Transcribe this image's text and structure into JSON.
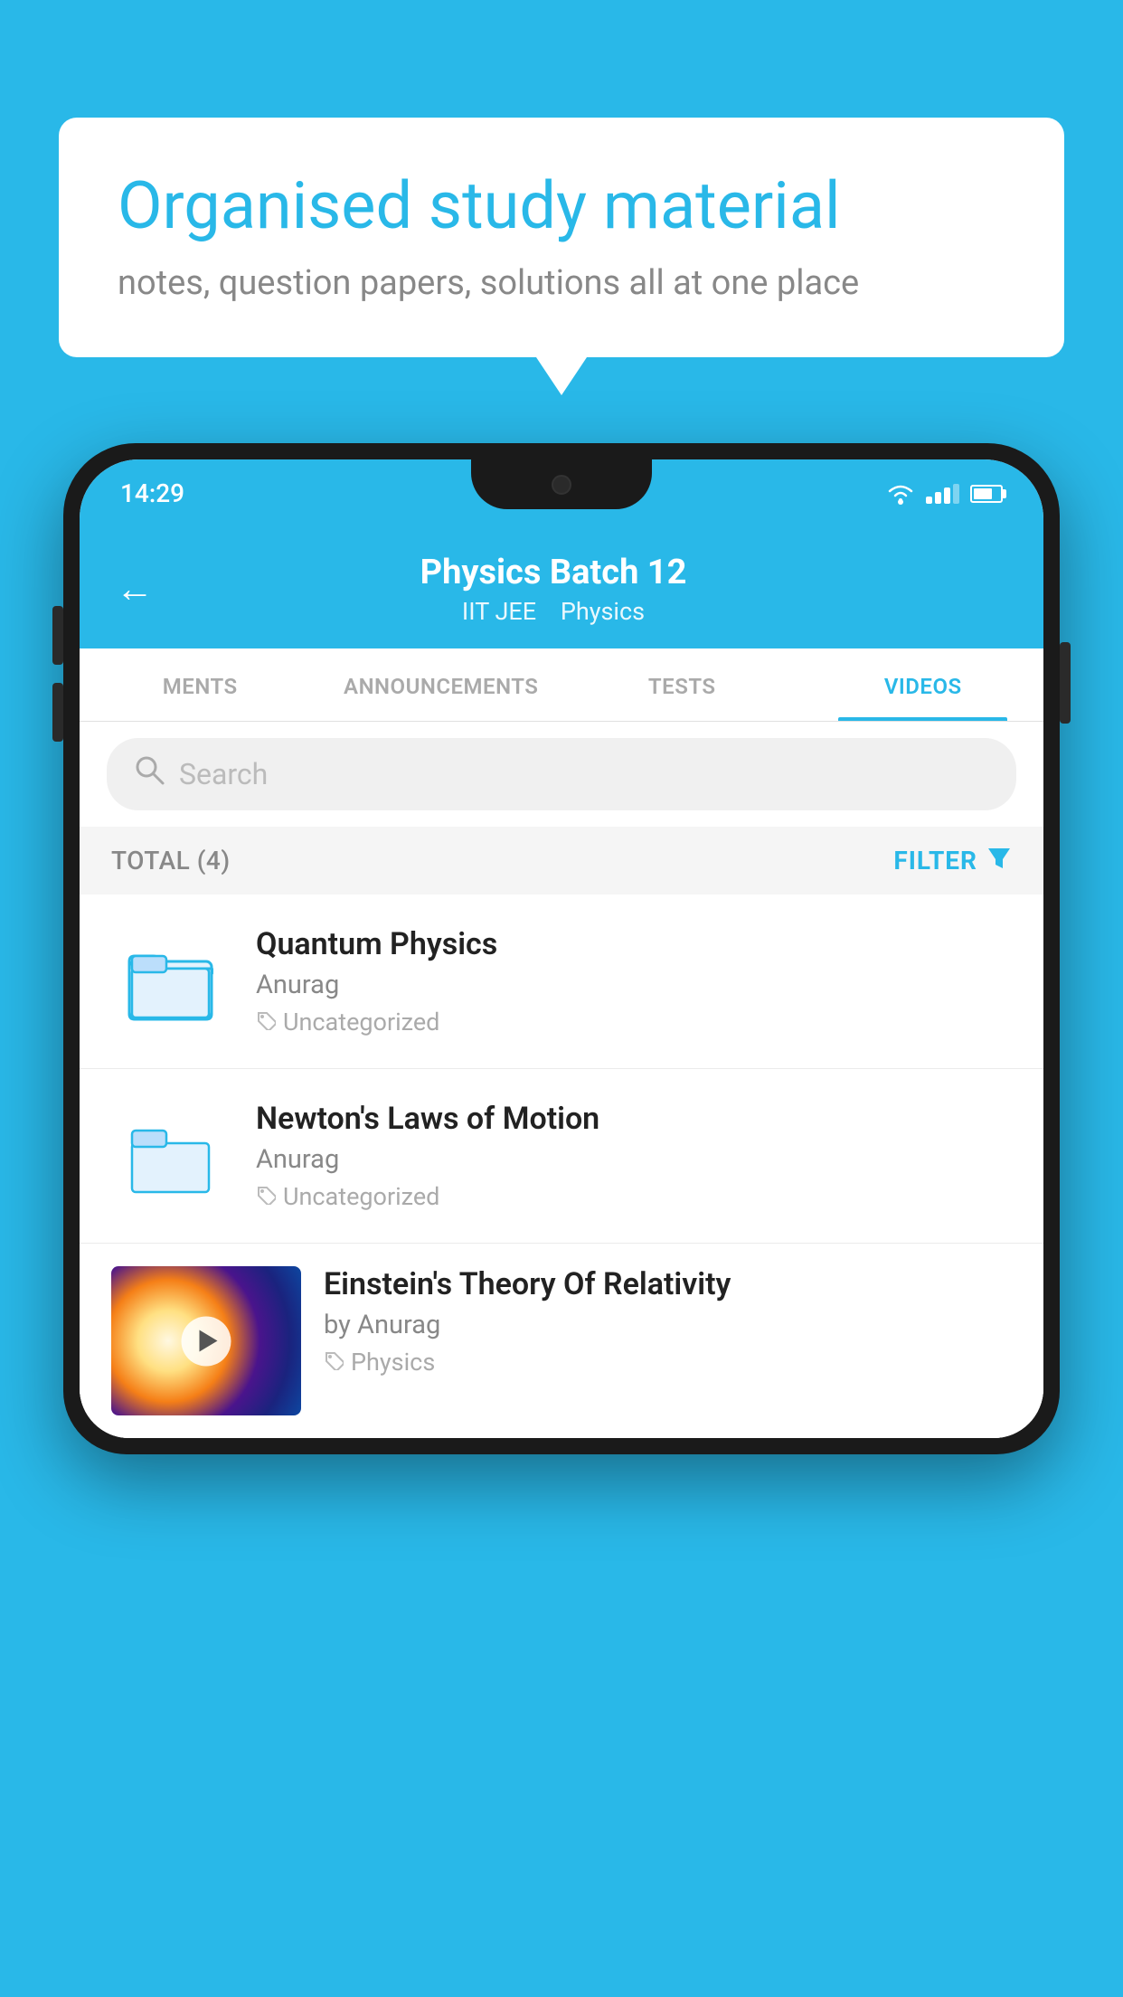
{
  "background_color": "#29b8e8",
  "bubble": {
    "title": "Organised study material",
    "subtitle": "notes, question papers, solutions all at one place"
  },
  "status_bar": {
    "time": "14:29",
    "wifi": "▼",
    "battery_percent": 70
  },
  "header": {
    "title": "Physics Batch 12",
    "subtitle_part1": "IIT JEE",
    "subtitle_part2": "Physics",
    "back_label": "←"
  },
  "tabs": [
    {
      "label": "MENTS",
      "active": false
    },
    {
      "label": "ANNOUNCEMENTS",
      "active": false
    },
    {
      "label": "TESTS",
      "active": false
    },
    {
      "label": "VIDEOS",
      "active": true
    }
  ],
  "search": {
    "placeholder": "Search"
  },
  "filter_bar": {
    "total_label": "TOTAL (4)",
    "filter_label": "FILTER"
  },
  "videos": [
    {
      "id": 1,
      "title": "Quantum Physics",
      "author": "Anurag",
      "tag": "Uncategorized",
      "has_thumbnail": false
    },
    {
      "id": 2,
      "title": "Newton's Laws of Motion",
      "author": "Anurag",
      "tag": "Uncategorized",
      "has_thumbnail": false
    },
    {
      "id": 3,
      "title": "Einstein's Theory Of Relativity",
      "author": "by Anurag",
      "tag": "Physics",
      "has_thumbnail": true
    }
  ]
}
